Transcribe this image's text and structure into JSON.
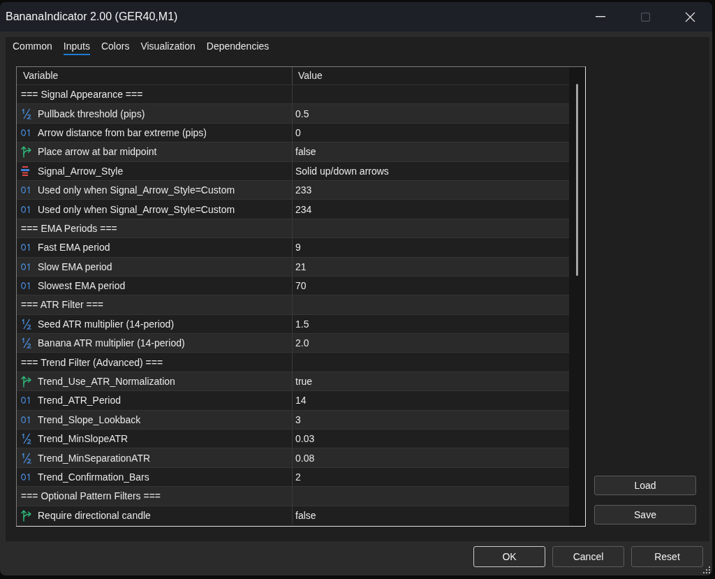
{
  "window": {
    "title": "BananaIndicator 2.00 (GER40,M1)"
  },
  "title_buttons": [
    {
      "kind": "minimize",
      "disabled": false
    },
    {
      "kind": "maximize",
      "disabled": true
    },
    {
      "kind": "close",
      "disabled": false
    }
  ],
  "tabs": [
    {
      "label": "Common",
      "selected": false
    },
    {
      "label": "Inputs",
      "selected": true
    },
    {
      "label": "Colors",
      "selected": false
    },
    {
      "label": "Visualization",
      "selected": false
    },
    {
      "label": "Dependencies",
      "selected": false
    }
  ],
  "table": {
    "columns": [
      "Variable",
      "Value"
    ],
    "rows": [
      {
        "kind": "section",
        "variable": "=== Signal Appearance ==="
      },
      {
        "kind": "double",
        "variable": "Pullback threshold (pips)",
        "value": "0.5"
      },
      {
        "kind": "int",
        "variable": "Arrow distance from bar extreme (pips)",
        "value": "0"
      },
      {
        "kind": "bool",
        "variable": "Place arrow at bar midpoint",
        "value": "false"
      },
      {
        "kind": "enum",
        "variable": "Signal_Arrow_Style",
        "value": "Solid up/down arrows"
      },
      {
        "kind": "int",
        "variable": "Used only when Signal_Arrow_Style=Custom",
        "value": "233"
      },
      {
        "kind": "int",
        "variable": "Used only when Signal_Arrow_Style=Custom",
        "value": "234"
      },
      {
        "kind": "section",
        "variable": "=== EMA Periods ==="
      },
      {
        "kind": "int",
        "variable": "Fast EMA period",
        "value": "9"
      },
      {
        "kind": "int",
        "variable": "Slow EMA period",
        "value": "21"
      },
      {
        "kind": "int",
        "variable": "Slowest EMA period",
        "value": "70"
      },
      {
        "kind": "section",
        "variable": "=== ATR Filter ==="
      },
      {
        "kind": "double",
        "variable": "Seed ATR multiplier (14-period)",
        "value": "1.5"
      },
      {
        "kind": "double",
        "variable": "Banana ATR multiplier (14-period)",
        "value": "2.0"
      },
      {
        "kind": "section",
        "variable": "=== Trend Filter (Advanced) ==="
      },
      {
        "kind": "bool",
        "variable": "Trend_Use_ATR_Normalization",
        "value": "true"
      },
      {
        "kind": "int",
        "variable": "Trend_ATR_Period",
        "value": "14"
      },
      {
        "kind": "int",
        "variable": "Trend_Slope_Lookback",
        "value": "3"
      },
      {
        "kind": "double",
        "variable": "Trend_MinSlopeATR",
        "value": "0.03"
      },
      {
        "kind": "double",
        "variable": "Trend_MinSeparationATR",
        "value": "0.08"
      },
      {
        "kind": "int",
        "variable": "Trend_Confirmation_Bars",
        "value": "2"
      },
      {
        "kind": "section",
        "variable": "=== Optional Pattern Filters ==="
      },
      {
        "kind": "bool",
        "variable": "Require directional candle",
        "value": "false"
      }
    ]
  },
  "side_buttons": [
    "Load",
    "Save"
  ],
  "buttons": [
    {
      "label": "OK",
      "default": true
    },
    {
      "label": "Cancel",
      "default": false
    },
    {
      "label": "Reset",
      "default": false
    }
  ]
}
